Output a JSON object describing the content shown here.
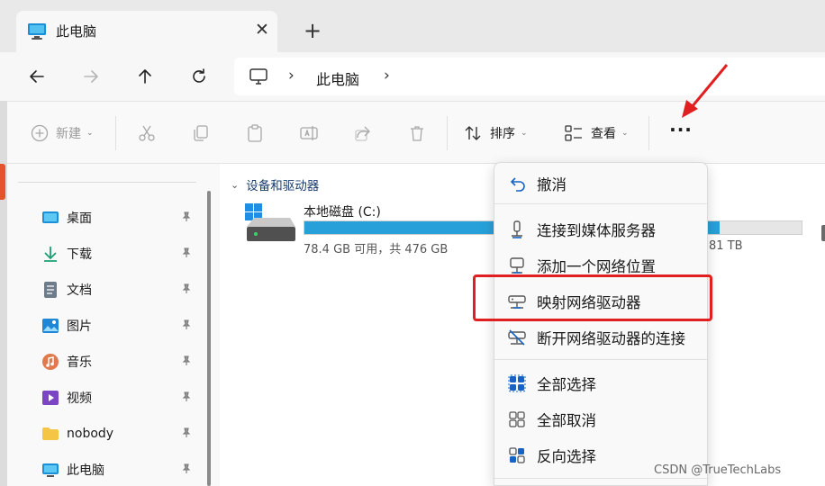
{
  "tab": {
    "title": "此电脑",
    "close_glyph": "✕",
    "new_tab_glyph": "+"
  },
  "nav": {
    "back_icon": "arrow-left-icon",
    "forward_icon": "arrow-right-icon",
    "up_icon": "arrow-up-icon",
    "refresh_icon": "refresh-icon",
    "address": {
      "sep": "›",
      "location": "此电脑"
    }
  },
  "toolbar": {
    "new_label": "新建",
    "sort_label": "排序",
    "view_label": "查看",
    "more_label": "···",
    "caret": "⌄"
  },
  "sidebar": {
    "pin_glyph": "📌",
    "items": [
      {
        "label": "桌面",
        "icon": "desktop-icon"
      },
      {
        "label": "下载",
        "icon": "download-icon"
      },
      {
        "label": "文档",
        "icon": "document-icon"
      },
      {
        "label": "图片",
        "icon": "pictures-icon"
      },
      {
        "label": "音乐",
        "icon": "music-icon"
      },
      {
        "label": "视频",
        "icon": "video-icon"
      },
      {
        "label": "nobody",
        "icon": "folder-icon"
      },
      {
        "label": "此电脑",
        "icon": "pc-icon"
      }
    ]
  },
  "content": {
    "group_label": "设备和驱动器",
    "group_chevron": "⌄",
    "drive": {
      "name": "本地磁盘 (C:)",
      "size_text": "78.4 GB 可用，共 476 GB",
      "used_fraction": 0.835,
      "second_drive_partial_size": "81 TB"
    }
  },
  "menu": {
    "items": [
      {
        "label": "撤消",
        "icon": "undo-icon"
      },
      {
        "label": "连接到媒体服务器",
        "icon": "media-server-icon"
      },
      {
        "label": "添加一个网络位置",
        "icon": "network-location-icon"
      },
      {
        "label": "映射网络驱动器",
        "icon": "map-network-drive-icon"
      },
      {
        "label": "断开网络驱动器的连接",
        "icon": "disconnect-network-drive-icon"
      },
      {
        "label": "全部选择",
        "icon": "select-all-icon"
      },
      {
        "label": "全部取消",
        "icon": "select-none-icon"
      },
      {
        "label": "反向选择",
        "icon": "invert-selection-icon"
      }
    ]
  },
  "colors": {
    "accent": "#27a0d9",
    "highlight_box": "#e02020",
    "annotation_arrow": "#e02020"
  },
  "watermark": "CSDN @TrueTechLabs"
}
